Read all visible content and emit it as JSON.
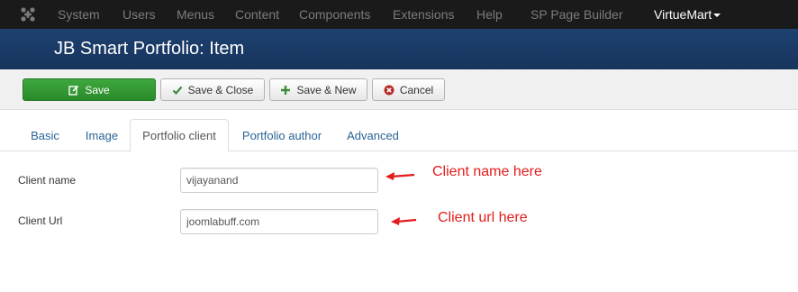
{
  "topnav": {
    "items": [
      {
        "label": "System"
      },
      {
        "label": "Users"
      },
      {
        "label": "Menus"
      },
      {
        "label": "Content"
      },
      {
        "label": "Components"
      },
      {
        "label": "Extensions"
      },
      {
        "label": "Help"
      },
      {
        "label": "SP Page Builder"
      },
      {
        "label": "VirtueMart"
      }
    ],
    "logo_icon": "joomla-logo-icon"
  },
  "header": {
    "title": "JB Smart Portfolio: Item"
  },
  "toolbar": {
    "save_label": "Save",
    "save_close_label": "Save & Close",
    "save_new_label": "Save & New",
    "cancel_label": "Cancel",
    "colors": {
      "save_bg": "#35a035",
      "check": "#3d8b3d",
      "plus": "#3d8b3d",
      "cancel_icon": "#b52b27"
    }
  },
  "tabs": [
    {
      "label": "Basic"
    },
    {
      "label": "Image"
    },
    {
      "label": "Portfolio client",
      "active": true
    },
    {
      "label": "Portfolio author"
    },
    {
      "label": "Advanced"
    }
  ],
  "form": {
    "client_name": {
      "label": "Client name",
      "value": "vijayanand"
    },
    "client_url": {
      "label": "Client Url",
      "value": "joomlabuff.com"
    }
  },
  "annotations": {
    "client_name_note": "Client name here",
    "client_url_note": "Client url here",
    "color": "#e51c1c"
  }
}
